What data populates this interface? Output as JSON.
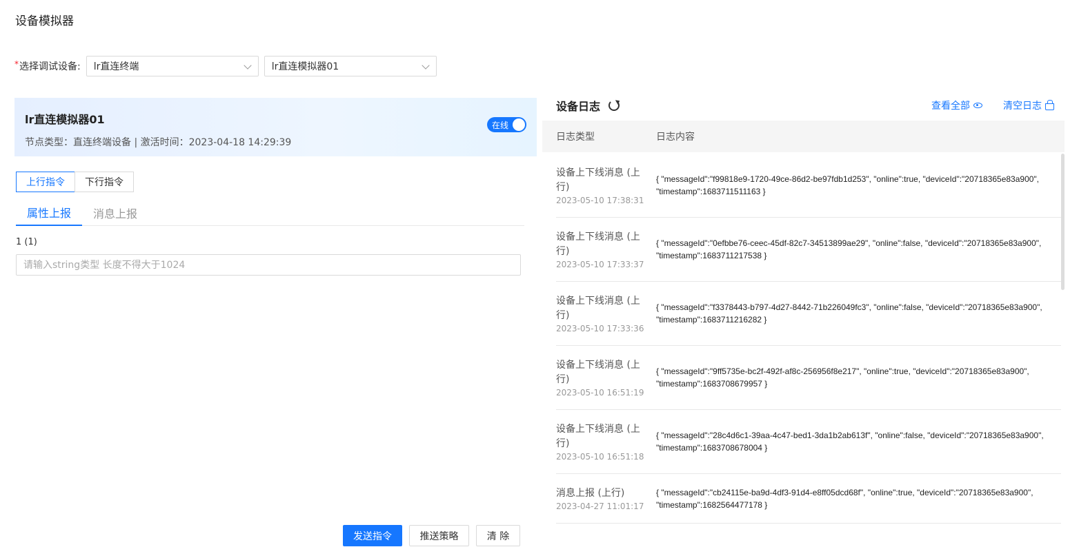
{
  "page": {
    "title": "设备模拟器"
  },
  "device_select": {
    "label": "选择调试设备:",
    "product_value": "lr直连终端",
    "device_value": "lr直连模拟器01"
  },
  "device_card": {
    "name": "lr直连模拟器01",
    "meta": "节点类型：直连终端设备 | 激活时间：2023-04-18 14:29:39",
    "status_label": "在线",
    "status_color": "#1677ff"
  },
  "command_tabs": [
    {
      "label": "上行指令"
    },
    {
      "label": "下行指令"
    }
  ],
  "sub_tabs": [
    {
      "label": "属性上报"
    },
    {
      "label": "消息上报"
    }
  ],
  "field": {
    "label": "1 (1)",
    "value": "",
    "placeholder": "请输入string类型 长度不得大于1024"
  },
  "buttons": {
    "send": "发送指令",
    "strategy": "推送策略",
    "clear": "清 除"
  },
  "log": {
    "title": "设备日志",
    "view_all": "查看全部",
    "clear_log": "清空日志",
    "col_type": "日志类型",
    "col_content": "日志内容",
    "rows": [
      {
        "type": "设备上下线消息 (上行)",
        "time": "2023-05-10 17:38:31",
        "content": "{ \"messageId\":\"f99818e9-1720-49ce-86d2-be97fdb1d253\", \"online\":true, \"deviceId\":\"20718365e83a900\", \"timestamp\":1683711511163 }"
      },
      {
        "type": "设备上下线消息 (上行)",
        "time": "2023-05-10 17:33:37",
        "content": "{ \"messageId\":\"0efbbe76-ceec-45df-82c7-34513899ae29\", \"online\":false, \"deviceId\":\"20718365e83a900\", \"timestamp\":1683711217538 }"
      },
      {
        "type": "设备上下线消息 (上行)",
        "time": "2023-05-10 17:33:36",
        "content": "{ \"messageId\":\"f3378443-b797-4d27-8442-71b226049fc3\", \"online\":false, \"deviceId\":\"20718365e83a900\", \"timestamp\":1683711216282 }"
      },
      {
        "type": "设备上下线消息 (上行)",
        "time": "2023-05-10 16:51:19",
        "content": "{ \"messageId\":\"9ff5735e-bc2f-492f-af8c-256956f8e217\", \"online\":true, \"deviceId\":\"20718365e83a900\", \"timestamp\":1683708679957 }"
      },
      {
        "type": "设备上下线消息 (上行)",
        "time": "2023-05-10 16:51:18",
        "content": "{ \"messageId\":\"28c4d6c1-39aa-4c47-bed1-3da1b2ab613f\", \"online\":false, \"deviceId\":\"20718365e83a900\", \"timestamp\":1683708678004 }"
      },
      {
        "type": "消息上报 (上行)",
        "time": "2023-04-27 11:01:17",
        "content": "{ \"messageId\":\"cb24115e-ba9d-4df3-91d4-e8ff05dcd68f\", \"online\":true, \"deviceId\":\"20718365e83a900\", \"timestamp\":1682564477178 }"
      }
    ]
  }
}
